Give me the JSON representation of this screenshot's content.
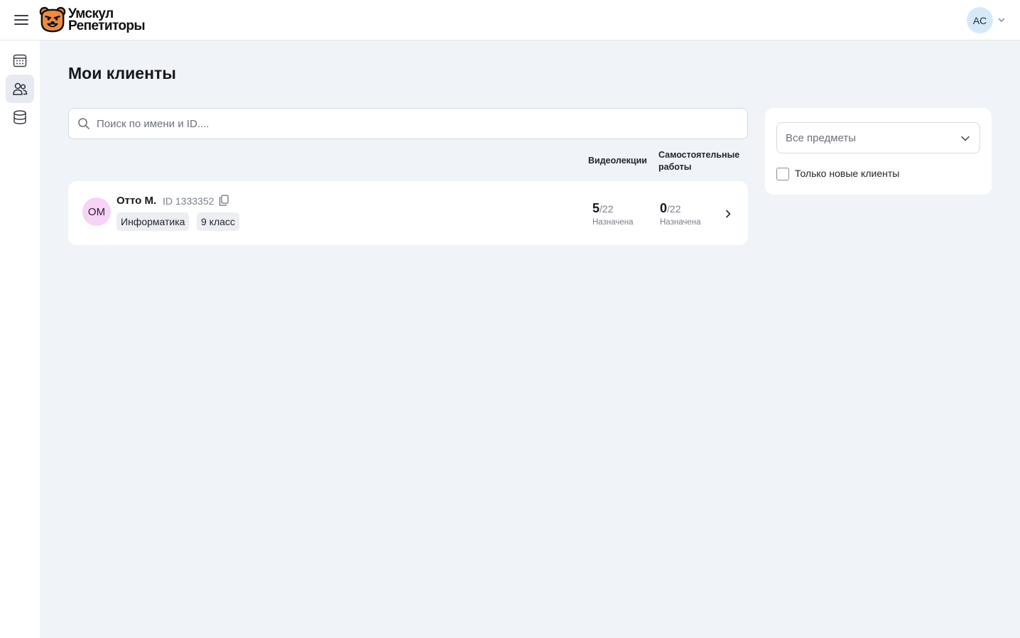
{
  "header": {
    "logo_line1": "Умскул",
    "logo_line2": "Репетиторы",
    "user_initials": "АС"
  },
  "sidebar": {
    "items": [
      {
        "icon": "calendar-icon",
        "active": false
      },
      {
        "icon": "users-icon",
        "active": true
      },
      {
        "icon": "database-icon",
        "active": false
      }
    ]
  },
  "page": {
    "title": "Мои клиенты",
    "search_placeholder": "Поиск по имени и ID...."
  },
  "columns": {
    "video": "Видеолекции",
    "self_line1": "Самостоятельные",
    "self_line2": "работы"
  },
  "clients": [
    {
      "initials": "ОМ",
      "name": "Отто М.",
      "id_text": "ID 1333352",
      "tags": [
        "Информатика",
        "9 класс"
      ],
      "video_done": "5",
      "video_total": "/22",
      "video_label": "Назначена",
      "self_done": "0",
      "self_total": "/22",
      "self_label": "Назначена"
    }
  ],
  "filters": {
    "subject_placeholder": "Все предметы",
    "new_only_label": "Только новые клиенты",
    "new_only_checked": false
  },
  "colors": {
    "background": "#f0f3f8",
    "brand_orange": "#f08a3c",
    "client_avatar": "#f6d3f7",
    "user_avatar": "#d6e9f9"
  }
}
